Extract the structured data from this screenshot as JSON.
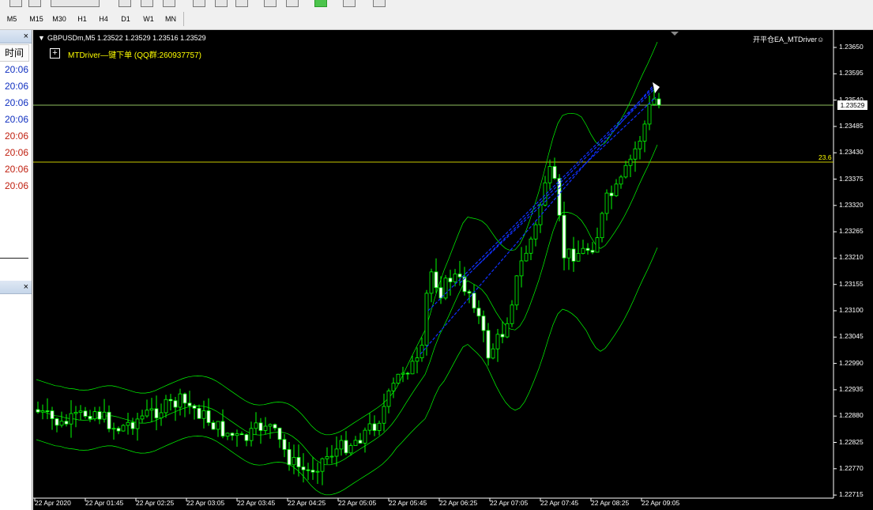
{
  "timeframes": [
    "M5",
    "M15",
    "M30",
    "H1",
    "H4",
    "D1",
    "W1",
    "MN"
  ],
  "left_panel": {
    "column_header": "时间",
    "times": [
      {
        "text": "20:06",
        "color": "#1030c0"
      },
      {
        "text": "20:06",
        "color": "#1030c0"
      },
      {
        "text": "20:06",
        "color": "#1030c0"
      },
      {
        "text": "20:06",
        "color": "#1030c0"
      },
      {
        "text": "20:06",
        "color": "#c02010"
      },
      {
        "text": "20:06",
        "color": "#c02010"
      },
      {
        "text": "20:06",
        "color": "#c02010"
      },
      {
        "text": "20:06",
        "color": "#c02010"
      }
    ],
    "close_symbol": "×"
  },
  "chart": {
    "symbol_header": "GBPUSDm,M5  1.23522 1.23529 1.23516 1.23529",
    "ea_name": "开平仓EA_MTDriver☺",
    "plus_symbol": "+",
    "ea_label": "MTDriver—键下单 (QQ群:260937757)",
    "current_price": "1.23529",
    "fib_level_label": "23.6",
    "price_labels": [
      "1.23650",
      "1.23595",
      "1.23540",
      "1.23485",
      "1.23430",
      "1.23375",
      "1.23320",
      "1.23265",
      "1.23210",
      "1.23155",
      "1.23100",
      "1.23045",
      "1.22990",
      "1.22935",
      "1.22880",
      "1.22825",
      "1.22770",
      "1.22715"
    ],
    "time_labels": [
      "22 Apr 2020",
      "22 Apr 01:45",
      "22 Apr 02:25",
      "22 Apr 03:05",
      "22 Apr 03:45",
      "22 Apr 04:25",
      "22 Apr 05:05",
      "22 Apr 05:45",
      "22 Apr 06:25",
      "22 Apr 07:05",
      "22 Apr 07:45",
      "22 Apr 08:25",
      "22 Apr 09:05"
    ],
    "colors": {
      "bull": "#00ff00",
      "bear_fill": "#ffffff",
      "bands": "#00ff00",
      "horizontal_line": "#c0ff80",
      "trend_lines": "#1030ff",
      "fib_line": "#c8c800"
    }
  },
  "chart_data": {
    "type": "candlestick",
    "symbol": "GBPUSDm",
    "timeframe": "M5",
    "y_range": [
      1.22715,
      1.2365
    ],
    "x_range": [
      "22 Apr 2020",
      "22 Apr 09:05"
    ],
    "current_price": 1.23529,
    "fib_level": {
      "label": "23.6",
      "price": 1.2341
    },
    "indicators": [
      "bollinger_bands"
    ]
  }
}
